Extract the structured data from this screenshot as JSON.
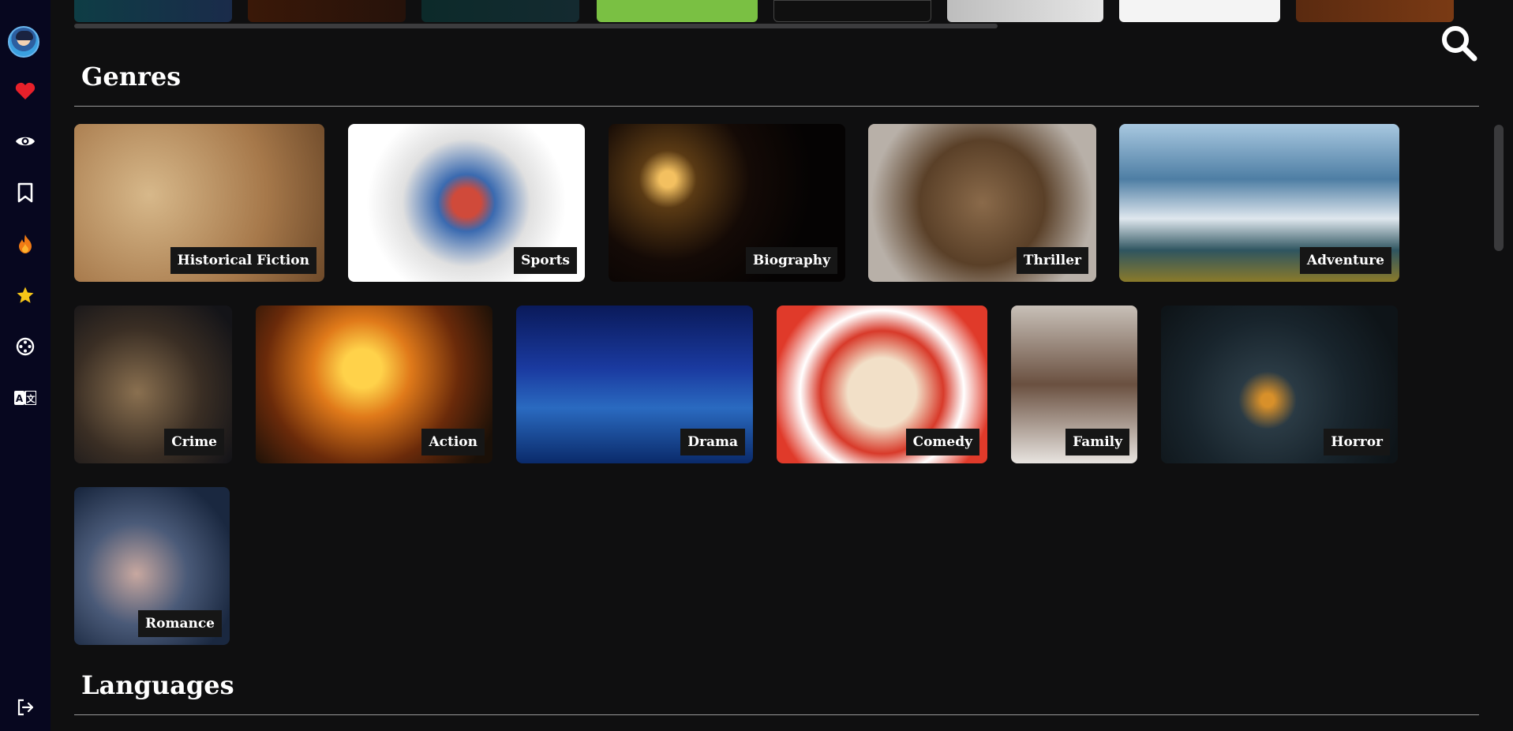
{
  "sidebar": {
    "items": [
      {
        "name": "avatar",
        "icon": "user-avatar"
      },
      {
        "name": "favorites",
        "icon": "heart-icon",
        "color": "#e8202a"
      },
      {
        "name": "watched",
        "icon": "eye-icon"
      },
      {
        "name": "watchlist",
        "icon": "bookmark-icon"
      },
      {
        "name": "trending",
        "icon": "flame-icon",
        "color": "#f07a14"
      },
      {
        "name": "top-rated",
        "icon": "star-icon",
        "color": "#f5c518"
      },
      {
        "name": "genres",
        "icon": "film-reel-icon"
      },
      {
        "name": "languages",
        "icon": "translate-icon"
      },
      {
        "name": "logout",
        "icon": "logout-icon"
      }
    ]
  },
  "search": {
    "icon": "search-icon"
  },
  "sections": {
    "genres_title": "Genres",
    "languages_title": "Languages"
  },
  "genres": [
    {
      "label": "Historical Fiction"
    },
    {
      "label": "Sports"
    },
    {
      "label": "Biography"
    },
    {
      "label": "Thriller"
    },
    {
      "label": "Adventure"
    },
    {
      "label": "Crime"
    },
    {
      "label": "Action"
    },
    {
      "label": "Drama"
    },
    {
      "label": "Comedy"
    },
    {
      "label": "Family"
    },
    {
      "label": "Horror"
    },
    {
      "label": "Romance"
    }
  ],
  "colors": {
    "background": "#0f0f10",
    "sidebar": "#07071f",
    "label_bg": "#161616"
  }
}
